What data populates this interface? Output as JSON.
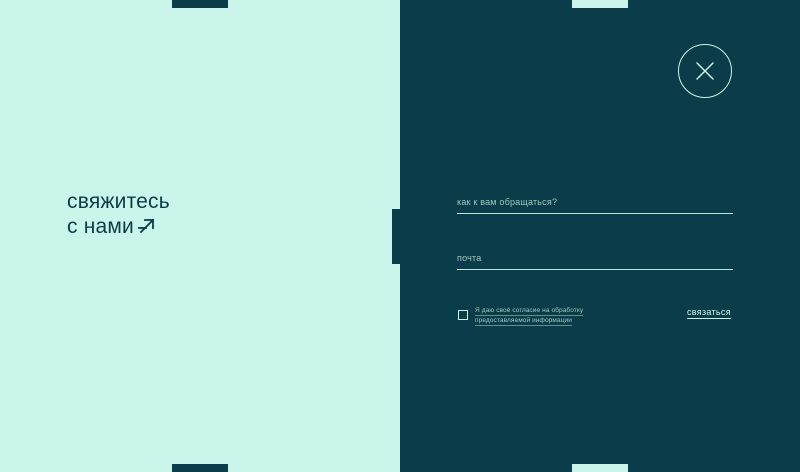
{
  "heading": {
    "line1": "свяжитесь",
    "line2": "с нами"
  },
  "icons": {
    "heading_arrow": "arrow-up-right-icon",
    "close": "close-icon"
  },
  "form": {
    "name_placeholder": "как к вам обращаться?",
    "email_placeholder": "почта",
    "consent_line1": "Я даю своё согласие на обработку",
    "consent_line2": "предоставляемой информации",
    "consent_checked": false,
    "submit_label": "связаться"
  },
  "colors": {
    "mint": "#caf5ea",
    "teal_dark": "#0b3c4a"
  }
}
